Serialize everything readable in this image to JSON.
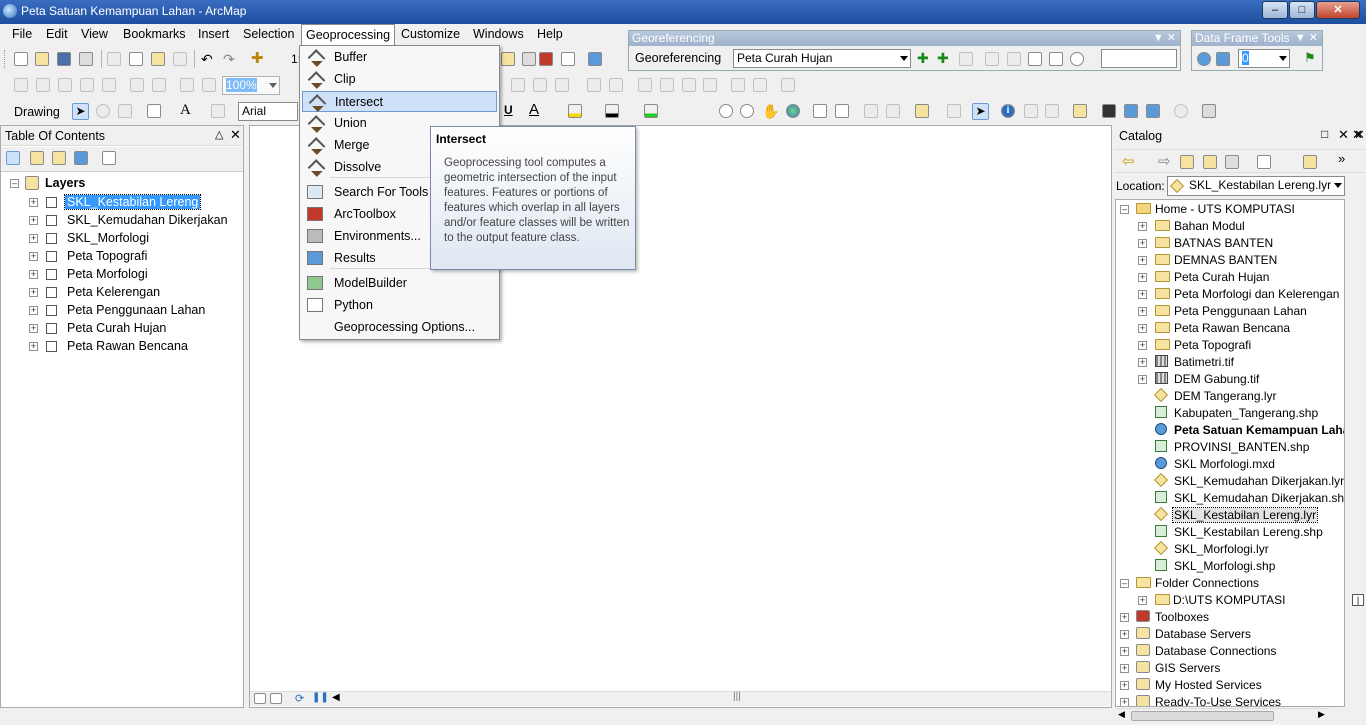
{
  "app": {
    "title": "Peta Satuan Kemampuan Lahan - ArcMap"
  },
  "menubar": {
    "items": [
      "File",
      "Edit",
      "View",
      "Bookmarks",
      "Insert",
      "Selection",
      "Geoprocessing",
      "Customize",
      "Windows",
      "Help"
    ]
  },
  "toolbars": {
    "drawing_label": "Drawing",
    "font_name": "Arial",
    "zoom_value": "100%",
    "scale_prefix": "1:"
  },
  "georeferencing": {
    "title": "Georeferencing",
    "menu_label": "Georeferencing",
    "layer_value": "Peta Curah Hujan",
    "scale_value": ""
  },
  "data_frame_tools": {
    "title": "Data Frame Tools",
    "rotate_value": "0"
  },
  "geoprocessing_menu": {
    "items": [
      "Buffer",
      "Clip",
      "Intersect",
      "Union",
      "Merge",
      "Dissolve",
      "Search For Tools",
      "ArcToolbox",
      "Environments...",
      "Results",
      "ModelBuilder",
      "Python",
      "Geoprocessing Options..."
    ],
    "highlighted": "Intersect"
  },
  "tooltip": {
    "title": "Intersect",
    "body": "Geoprocessing tool computes a geometric intersection of the input features. Features or portions of features which overlap in all layers and/or feature classes will be written to the output feature class."
  },
  "toc": {
    "title": "Table Of Contents",
    "root": "Layers",
    "layers": [
      "SKL_Kestabilan Lereng",
      "SKL_Kemudahan Dikerjakan",
      "SKL_Morfologi",
      "Peta Topografi",
      "Peta Morfologi",
      "Peta Kelerengan",
      "Peta Penggunaan Lahan",
      "Peta Curah Hujan",
      "Peta Rawan Bencana"
    ],
    "selected": "SKL_Kestabilan Lereng"
  },
  "catalog": {
    "title": "Catalog",
    "location_label": "Location:",
    "location_value": "SKL_Kestabilan Lereng.lyr",
    "home": "Home - UTS KOMPUTASI",
    "items": [
      {
        "label": "Bahan Modul",
        "type": "folder",
        "expand": true
      },
      {
        "label": "BATNAS BANTEN",
        "type": "folder",
        "expand": true
      },
      {
        "label": "DEMNAS BANTEN",
        "type": "folder",
        "expand": true
      },
      {
        "label": "Peta Curah Hujan",
        "type": "folder",
        "expand": true
      },
      {
        "label": "Peta Morfologi dan Kelerengan",
        "type": "folder",
        "expand": true
      },
      {
        "label": "Peta Penggunaan Lahan",
        "type": "folder",
        "expand": true
      },
      {
        "label": "Peta Rawan Bencana",
        "type": "folder",
        "expand": true
      },
      {
        "label": "Peta Topografi",
        "type": "folder",
        "expand": true
      },
      {
        "label": "Batimetri.tif",
        "type": "raster",
        "expand": true
      },
      {
        "label": "DEM Gabung.tif",
        "type": "raster",
        "expand": true
      },
      {
        "label": "DEM Tangerang.lyr",
        "type": "lyr",
        "expand": false
      },
      {
        "label": "Kabupaten_Tangerang.shp",
        "type": "shp",
        "expand": false
      },
      {
        "label": "Peta Satuan Kemampuan Lahan.mxd",
        "type": "mxd",
        "expand": false,
        "bold": true
      },
      {
        "label": "PROVINSI_BANTEN.shp",
        "type": "shp",
        "expand": false
      },
      {
        "label": "SKL Morfologi.mxd",
        "type": "mxd",
        "expand": false
      },
      {
        "label": "SKL_Kemudahan Dikerjakan.lyr",
        "type": "lyr",
        "expand": false
      },
      {
        "label": "SKL_Kemudahan Dikerjakan.shp",
        "type": "shp",
        "expand": false
      },
      {
        "label": "SKL_Kestabilan Lereng.lyr",
        "type": "lyr",
        "expand": false,
        "selected": true
      },
      {
        "label": "SKL_Kestabilan Lereng.shp",
        "type": "shp",
        "expand": false
      },
      {
        "label": "SKL_Morfologi.lyr",
        "type": "lyr",
        "expand": false
      },
      {
        "label": "SKL_Morfologi.shp",
        "type": "shp",
        "expand": false
      }
    ],
    "folder_connections": "Folder Connections",
    "folder_connection_child": "D:\\UTS KOMPUTASI",
    "roots": [
      "Toolboxes",
      "Database Servers",
      "Database Connections",
      "GIS Servers",
      "My Hosted Services",
      "Ready-To-Use Services"
    ]
  },
  "colors": {
    "titlebar": "#1d4ea0",
    "selection": "#3399ff",
    "menu_highlight": "#cfe1f8"
  }
}
